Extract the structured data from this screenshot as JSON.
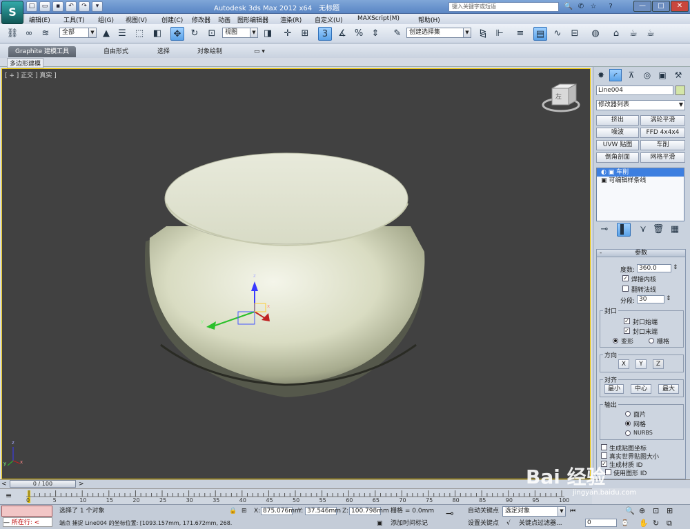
{
  "app": {
    "logo_text": "S",
    "title": "Autodesk 3ds Max  2012 x64",
    "document": "无标题",
    "search_placeholder": "键入关键字或短语",
    "window_min": "—",
    "window_max": "□",
    "window_close": "✕"
  },
  "menu": [
    "编辑(E)",
    "工具(T)",
    "组(G)",
    "视图(V)",
    "创建(C)",
    "修改器",
    "动画",
    "图形编辑器",
    "渲染(R)",
    "自定义(U)",
    "MAXScript(M)",
    "帮助(H)"
  ],
  "toolbar": {
    "selection_filter": "全部",
    "ref_coord": "视图",
    "named_selection": "创建选择集",
    "snap_label": "3",
    "percent_label": "%"
  },
  "ribbon": {
    "tabs": [
      "Graphite 建模工具",
      "自由形式",
      "选择",
      "对象绘制"
    ],
    "sub": "多边形建模"
  },
  "viewport": {
    "label": "[ + ] 正交 ] 真实 ]",
    "axis_x": "x",
    "axis_y": "y",
    "axis_z": "z",
    "viewcube_face": "左",
    "small_axis_y": "y",
    "small_axis_x": "x",
    "small_axis_z": "z"
  },
  "panel": {
    "object_name": "Line004",
    "modifier_list": "修改器列表",
    "modifier_buttons": [
      "挤出",
      "涡轮平滑",
      "噪波",
      "FFD 4x4x4",
      "UVW 贴图",
      "车削",
      "倒角剖面",
      "网格平滑"
    ],
    "stack": [
      "车削",
      "可编辑样条线"
    ],
    "params_title": "参数",
    "degrees_label": "度数:",
    "degrees_value": "360.0",
    "weld_core": "焊接内核",
    "flip_normals": "翻转法线",
    "segments_label": "分段:",
    "segments_value": "30",
    "capping_group": "封口",
    "cap_start": "封口始端",
    "cap_end": "封口末端",
    "morph": "变形",
    "grid": "栅格",
    "direction_group": "方向",
    "dir_x": "X",
    "dir_y": "Y",
    "dir_z": "Z",
    "align_group": "对齐",
    "align_min": "最小",
    "align_center": "中心",
    "align_max": "最大",
    "output_group": "输出",
    "out_patch": "面片",
    "out_mesh": "网格",
    "out_nurbs": "NURBS",
    "gen_map": "生成贴图坐标",
    "real_world": "真实世界贴图大小",
    "gen_mat": "生成材质 ID",
    "use_shape": "使用图形 ID"
  },
  "timeline": {
    "frame": "0 / 100",
    "ticks": [
      "0",
      "5",
      "10",
      "15",
      "20",
      "25",
      "30",
      "35",
      "40",
      "45",
      "50",
      "55",
      "60",
      "65",
      "70",
      "75",
      "80",
      "85",
      "90",
      "95",
      "100"
    ]
  },
  "status": {
    "running": "所在行:",
    "selected": "选择了 1 个对象",
    "prompt": "端点 捕捉 Line004 的坐标位置: [1093.157mm, 171.672mm, 268.326mm]",
    "x_label": "X:",
    "x_value": "875.076mm",
    "y_label": "Y:",
    "y_value": "37.546mm",
    "z_label": "Z:",
    "z_value": "100.798mm",
    "grid": "栅格 = 0.0mm",
    "add_time_tag": "添加时间标记",
    "auto_key": "自动关键点",
    "selected_obj": "选定对象",
    "set_key": "设置关键点",
    "key_filters": "关键点过滤器...",
    "frame_value": "0"
  },
  "watermark": {
    "brand": "Bai 经验",
    "url": "jingyan.baidu.com"
  }
}
